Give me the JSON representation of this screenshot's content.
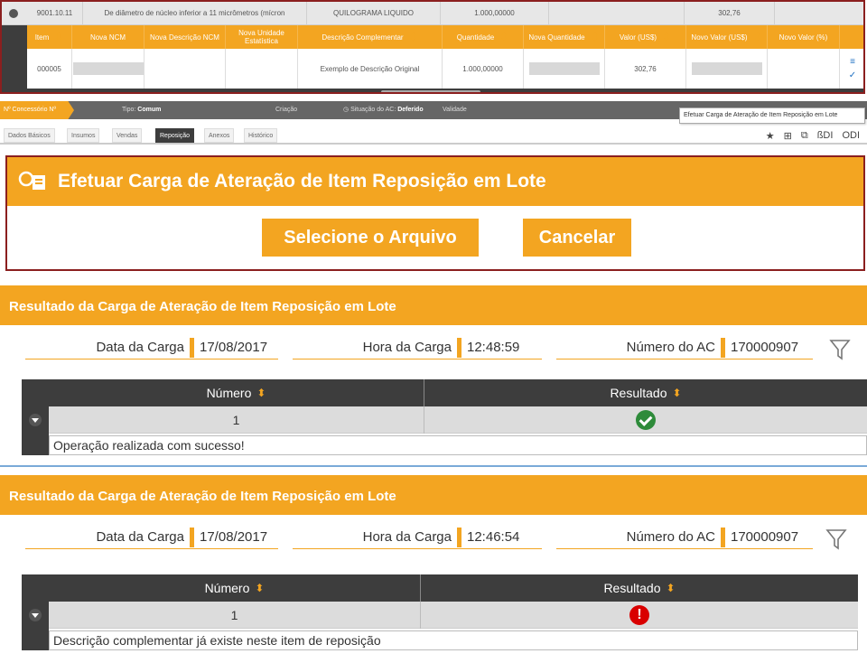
{
  "top_table": {
    "summary_row": [
      "9001.10.11",
      "De diâmetro de núcleo inferior a 11 micrômetros (mícron",
      "QUILOGRAMA LIQUIDO",
      "1.000,00000",
      "",
      "302,76"
    ],
    "headers": [
      "Item",
      "Nova NCM",
      "Nova Descrição NCM",
      "Nova Unidade Estatística",
      "Descrição Complementar",
      "Quantidade",
      "Nova Quantidade",
      "Valor (US$)",
      "Novo Valor (US$)",
      "Novo Valor (%)"
    ],
    "row": {
      "item": "000005",
      "descricao": "Exemplo de Descrição Original",
      "quantidade": "1.000,00000",
      "valor": "302,76"
    }
  },
  "nav": {
    "concession": "Nº Concessório Nº",
    "tipo_label": "Tipo:",
    "tipo_value": "Comum",
    "criacao": "Criação",
    "situacao_label": "Situação do AC:",
    "situacao_value": "Deferido",
    "validade": "Validade",
    "tooltip": "Efetuar Carga de Ateração de Item Reposição em Lote",
    "tabs": [
      "Dados Básicos",
      "Insumos",
      "Vendas",
      "Reposição",
      "Anexos",
      "Histórico"
    ],
    "active_tab": "Reposição",
    "icon_text_1": "ßDI",
    "icon_text_2": "ODI"
  },
  "dialog": {
    "title": "Efetuar Carga de Ateração de Item Reposição em Lote",
    "select_button": "Selecione o Arquivo",
    "cancel_button": "Cancelar"
  },
  "results": [
    {
      "title": "Resultado da Carga de Ateração de Item Reposição em Lote",
      "data_label": "Data da Carga",
      "data_value": "17/08/2017",
      "hora_label": "Hora da Carga",
      "hora_value": "12:48:59",
      "ac_label": "Número do AC",
      "ac_value": "170000907",
      "col_numero": "Número",
      "col_resultado": "Resultado",
      "numero": "1",
      "status": "success",
      "message": "Operação realizada com sucesso!"
    },
    {
      "title": "Resultado da Carga de Ateração de Item Reposição em Lote",
      "data_label": "Data da Carga",
      "data_value": "17/08/2017",
      "hora_label": "Hora da Carga",
      "hora_value": "12:46:54",
      "ac_label": "Número do AC",
      "ac_value": "170000907",
      "col_numero": "Número",
      "col_resultado": "Resultado",
      "numero": "1",
      "status": "error",
      "message": "Descrição complementar já existe neste item de reposição"
    }
  ],
  "colors": {
    "accent": "#f3a521",
    "dark": "#3d3d3d",
    "success": "#2e8b3a",
    "error": "#d90000"
  }
}
